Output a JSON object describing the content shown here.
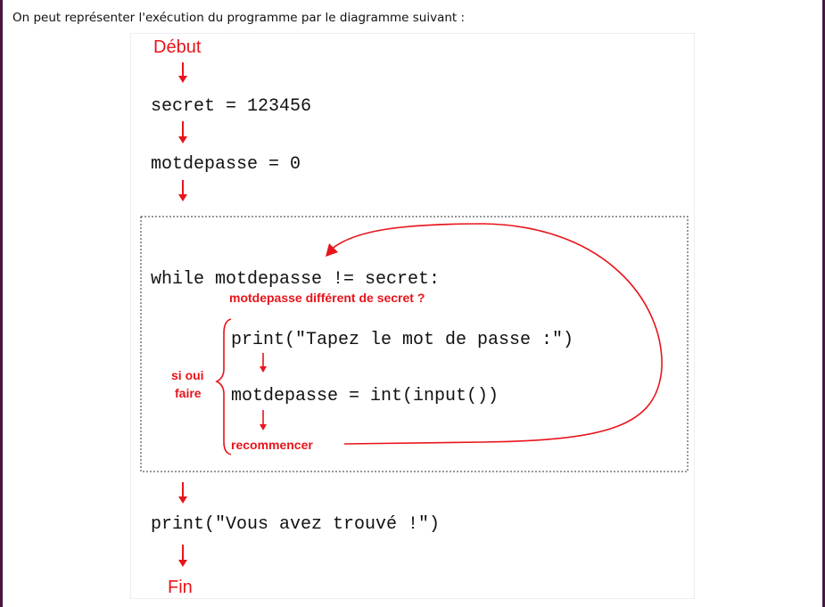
{
  "intro_text": "On peut représenter l'exécution du programme par le diagramme suivant :",
  "diagram": {
    "start_label": "Début",
    "end_label": "Fin",
    "lines": {
      "secret": "secret = 123456",
      "motdepasse_init": "motdepasse = 0",
      "while": "while motdepasse != secret:",
      "print_prompt": "print(\"Tapez le mot de passe :\")",
      "input": "motdepasse = int(input())",
      "print_found": "print(\"Vous avez trouvé !\")"
    },
    "annotations": {
      "condition": "motdepasse différent de secret ?",
      "si_oui": "si oui",
      "faire": "faire",
      "recommencer": "recommencer"
    },
    "colors": {
      "arrow": "#e8141b",
      "text": "#111111",
      "box_border": "#333333",
      "page_border": "#4a1642"
    }
  }
}
